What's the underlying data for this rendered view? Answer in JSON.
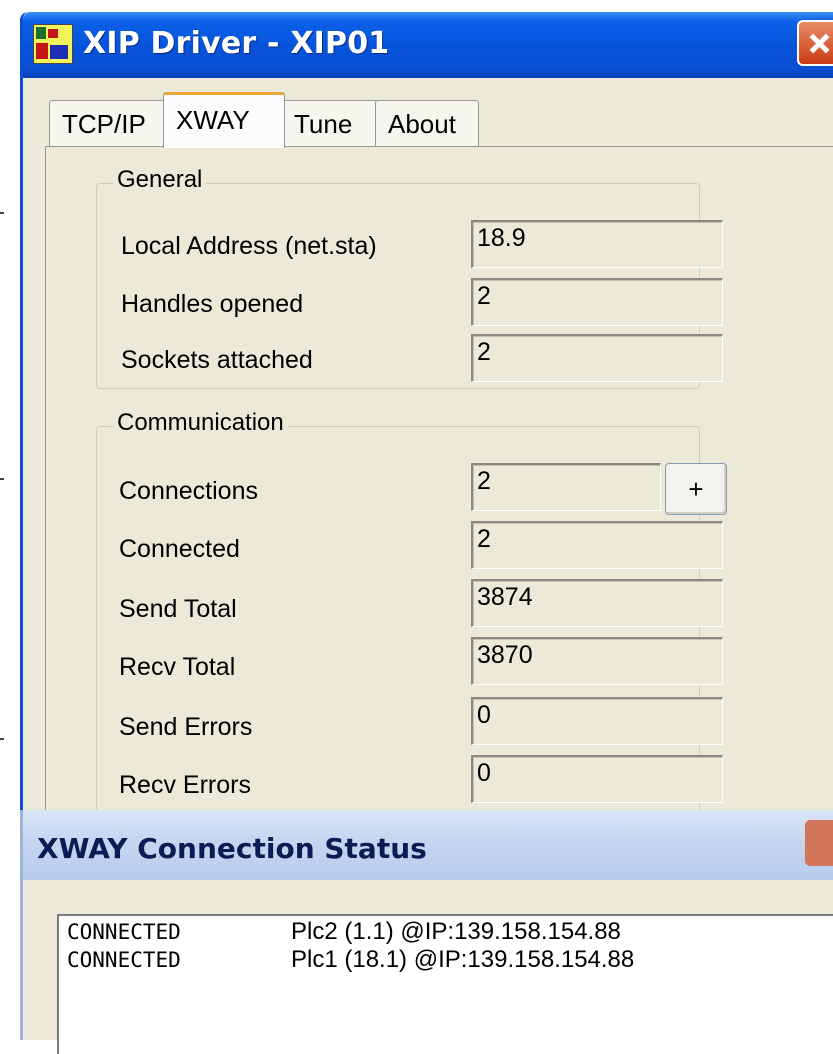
{
  "main_window": {
    "title": "XIP Driver - XIP01",
    "tabs": [
      {
        "label": "TCP/IP"
      },
      {
        "label": "XWAY"
      },
      {
        "label": "Tune"
      },
      {
        "label": "About"
      }
    ],
    "active_tab": "XWAY",
    "general": {
      "legend": "General",
      "rows": [
        {
          "label": "Local Address (net.sta)",
          "value": "18.9"
        },
        {
          "label": "Handles opened",
          "value": "2"
        },
        {
          "label": "Sockets attached",
          "value": "2"
        }
      ]
    },
    "communication": {
      "legend": "Communication",
      "expand_button_label": "+",
      "rows": [
        {
          "label": "Connections",
          "value": "2"
        },
        {
          "label": "Connected",
          "value": "2"
        },
        {
          "label": "Send Total",
          "value": "3874"
        },
        {
          "label": "Recv Total",
          "value": "3870"
        },
        {
          "label": "Send Errors",
          "value": "0"
        },
        {
          "label": "Recv Errors",
          "value": "0"
        }
      ]
    }
  },
  "status_window": {
    "title": "XWAY Connection Status",
    "entries": [
      {
        "state": "CONNECTED",
        "info": "Plc2 (1.1) @IP:139.158.154.88"
      },
      {
        "state": "CONNECTED",
        "info": "Plc1 (18.1) @IP:139.158.154.88"
      }
    ]
  }
}
